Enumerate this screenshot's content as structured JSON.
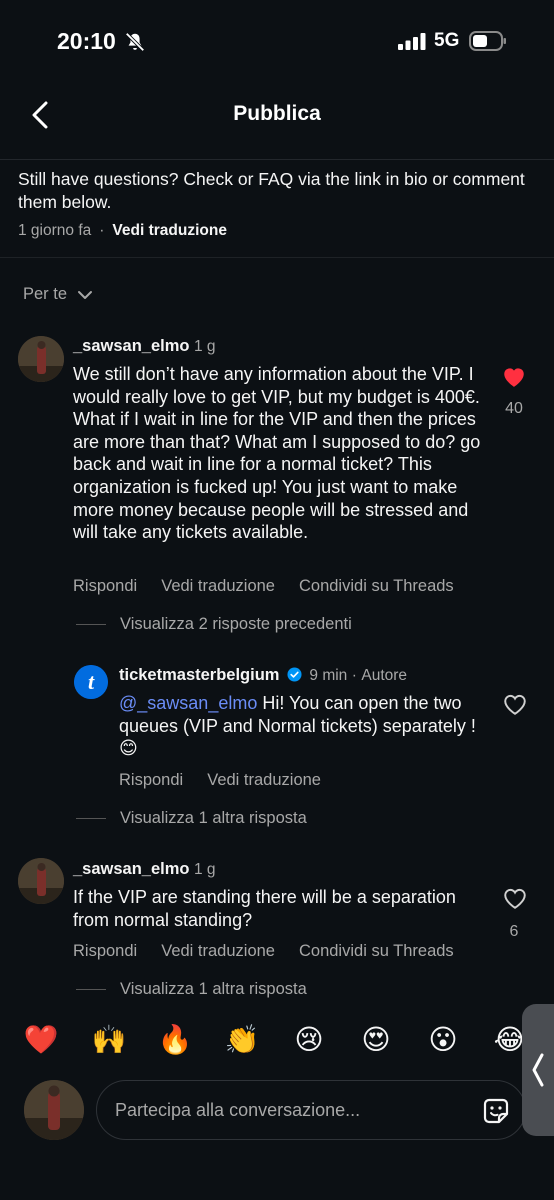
{
  "status_bar": {
    "time": "20:10",
    "network": "5G"
  },
  "header": {
    "title": "Pubblica"
  },
  "caption": {
    "text": "Still have questions? Check or FAQ via the link in bio or comment them below.",
    "time": "1 giorno fa",
    "separator": "·",
    "translate": "Vedi traduzione"
  },
  "sort": {
    "label": "Per te"
  },
  "comments": [
    {
      "username": "_sawsan_elmo",
      "time": "1 g",
      "text": "We still don’t have any information about the VIP. I would really love to get VIP, but my budget is 400€. What if I wait in line for the VIP and then the prices are more than that? What am I supposed to do? go back and wait in line for a normal ticket? This organization is fucked up! You just want to make more money because people will be stressed and will take any tickets available.",
      "likes": "40",
      "liked": true,
      "actions": {
        "reply": "Rispondi",
        "translate": "Vedi traduzione",
        "share": "Condividi su Threads"
      },
      "view_previous": "Visualizza 2 risposte precedenti"
    },
    {
      "username": "ticketmasterbelgium",
      "time": "9 min",
      "author_tag": "Autore",
      "author_sep": "·",
      "mention": "@_sawsan_elmo",
      "text": " Hi! You can open the two queues (VIP and Normal tickets) separately ! 😊",
      "actions": {
        "reply": "Rispondi",
        "translate": "Vedi traduzione"
      },
      "view_more": "Visualizza 1 altra risposta"
    },
    {
      "username": "_sawsan_elmo",
      "time": "1 g",
      "text": "If the VIP are standing there will be a separation from normal standing?",
      "likes": "6",
      "liked": false,
      "actions": {
        "reply": "Rispondi",
        "translate": "Vedi traduzione",
        "share": "Condividi su Threads"
      },
      "view_more": "Visualizza 1 altra risposta"
    }
  ],
  "emoji_bar": [
    "❤️",
    "🙌",
    "🔥",
    "👏",
    "😢",
    "😍",
    "😮",
    "😂"
  ],
  "input": {
    "placeholder": "Partecipa alla conversazione..."
  },
  "colors": {
    "background": "#0c1014",
    "text": "#f5f5f5",
    "muted": "#a8a8a8",
    "like_red": "#ff3040",
    "mention_blue": "#6b8df7",
    "verified_blue": "#0095f6",
    "ticketmaster_blue": "#026cdf"
  },
  "icons": {
    "back": "chevron-left-icon",
    "bell_off": "bell-slash-icon",
    "signal": "cellular-signal-icon",
    "battery": "battery-icon",
    "sort_chevron": "chevron-down-icon",
    "heart": "heart-icon",
    "verified": "verified-badge-icon",
    "sticker": "sticker-icon",
    "side_tab": "chevron-left-icon"
  }
}
